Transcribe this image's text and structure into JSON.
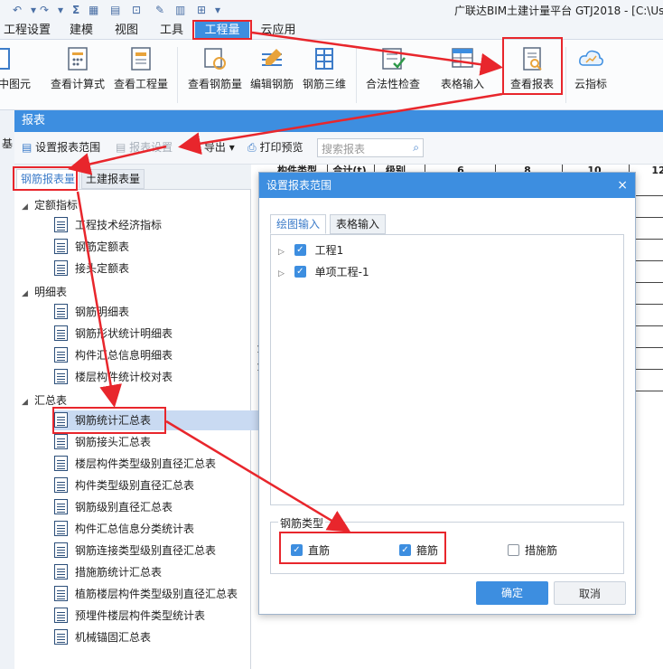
{
  "title": {
    "app": "广联达BIM土建计量平台 GTJ2018 - [C:\\Us"
  },
  "qbar": {
    "sum": "Σ"
  },
  "menu": [
    {
      "label": "工程设置"
    },
    {
      "label": "建模"
    },
    {
      "label": "视图"
    },
    {
      "label": "工具"
    },
    {
      "label": "工程量"
    },
    {
      "label": "云应用"
    }
  ],
  "ribbon": {
    "b0": "中图元",
    "b1": "查看计算式",
    "b2": "查看工程量",
    "b3": "查看钢筋量",
    "b4": "编辑钢筋",
    "b5": "钢筋三维",
    "b6": "合法性检查",
    "b7": "表格输入",
    "b8": "查看报表",
    "b9": "云指标"
  },
  "report": {
    "title": "报表",
    "toolbar": {
      "scope": "设置报表范围",
      "settings": "报表设置",
      "export": "导出",
      "print": "打印预览",
      "search_placeholder": "搜索报表"
    },
    "left_stub": "基",
    "tabs": {
      "rebar": "钢筋报表量",
      "civil": "土建报表量"
    },
    "groups": {
      "g1": "定额指标",
      "g2": "明细表",
      "g3": "汇总表"
    },
    "items": {
      "i1": "工程技术经济指标",
      "i2": "钢筋定额表",
      "i3": "接头定额表",
      "i4": "钢筋明细表",
      "i5": "钢筋形状统计明细表",
      "i6": "构件汇总信息明细表",
      "i7": "楼层构件统计校对表",
      "i8": "钢筋统计汇总表",
      "i9": "钢筋接头汇总表",
      "i10": "楼层构件类型级别直径汇总表",
      "i11": "构件类型级别直径汇总表",
      "i12": "钢筋级别直径汇总表",
      "i13": "构件汇总信息分类统计表",
      "i14": "钢筋连接类型级别直径汇总表",
      "i15": "措施筋统计汇总表",
      "i16": "植筋楼层构件类型级别直径汇总表",
      "i17": "预埋件楼层构件类型统计表",
      "i18": "机械锚固汇总表"
    },
    "table_headers": {
      "h1": "构件类型",
      "h2": "合计(t)",
      "h3": "级别",
      "h4": "6",
      "h5": "8",
      "h6": "10",
      "h7": "12"
    },
    "table_side": {
      "a": "1",
      "b": "1"
    }
  },
  "dialog": {
    "title": "设置报表范围",
    "close": "×",
    "tabs": {
      "draw": "绘图输入",
      "table": "表格输入"
    },
    "nodes": {
      "n1": "工程1",
      "n2": "单项工程-1"
    },
    "rebar_type": "钢筋类型",
    "options": {
      "straight": "直筋",
      "stirrup": "箍筋",
      "measure": "措施筋"
    },
    "ok": "确定",
    "cancel": "取消"
  },
  "colors": {
    "accent": "#3d8ee0",
    "annotation": "#e8262c"
  }
}
